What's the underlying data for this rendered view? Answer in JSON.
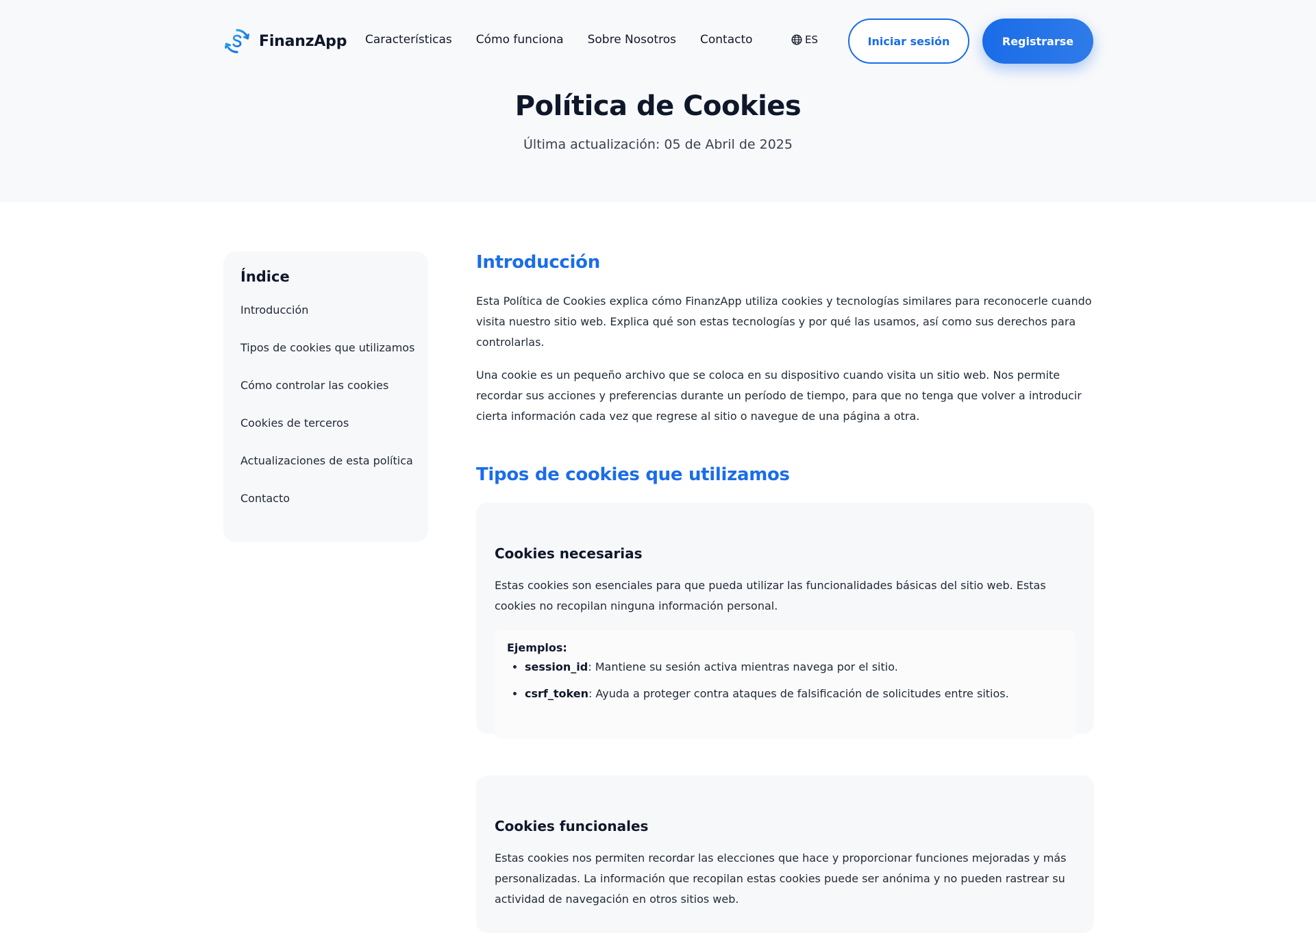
{
  "brand": {
    "name": "FinanzApp",
    "accent": "#1a6de8"
  },
  "nav": {
    "links": [
      "Características",
      "Cómo funciona",
      "Sobre Nosotros",
      "Contacto"
    ],
    "language": "ES",
    "login_label": "Iniciar sesión",
    "register_label": "Registrarse"
  },
  "hero": {
    "title": "Política de Cookies",
    "updated": "Última actualización: 05 de Abril de 2025"
  },
  "toc": {
    "title": "Índice",
    "items": [
      "Introducción",
      "Tipos de cookies que utilizamos",
      "Cómo controlar las cookies",
      "Cookies de terceros",
      "Actualizaciones de esta política",
      "Contacto"
    ]
  },
  "intro": {
    "title": "Introducción",
    "paragraphs": [
      "Esta Política de Cookies explica cómo FinanzApp utiliza cookies y tecnologías similares para reconocerle cuando visita nuestro sitio web. Explica qué son estas tecnologías y por qué las usamos, así como sus derechos para controlarlas.",
      "Una cookie es un pequeño archivo que se coloca en su dispositivo cuando visita un sitio web. Nos permite recordar sus acciones y preferencias durante un período de tiempo, para que no tenga que volver a introducir cierta información cada vez que regrese al sitio o navegue de una página a otra."
    ]
  },
  "types": {
    "title": "Tipos de cookies que utilizamos",
    "cards": [
      {
        "title": "Cookies necesarias",
        "description": "Estas cookies son esenciales para que pueda utilizar las funcionalidades básicas del sitio web. Estas cookies no recopilan ninguna información personal.",
        "examples_title": "Ejemplos:",
        "examples": [
          {
            "name": "session_id",
            "text": ": Mantiene su sesión activa mientras navega por el sitio."
          },
          {
            "name": "csrf_token",
            "text": ": Ayuda a proteger contra ataques de falsificación de solicitudes entre sitios."
          }
        ]
      },
      {
        "title": "Cookies funcionales",
        "description": "Estas cookies nos permiten recordar las elecciones que hace y proporcionar funciones mejoradas y más personalizadas. La información que recopilan estas cookies puede ser anónima y no pueden rastrear su actividad de navegación en otros sitios web."
      }
    ]
  }
}
